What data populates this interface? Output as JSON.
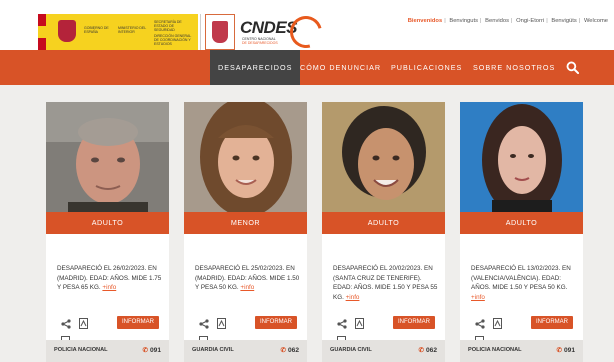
{
  "header": {
    "gov_logo": {
      "line1": "Gobierno de España",
      "line2": "Ministerio del Interior",
      "line3": "Secretaría de Estado de Seguridad",
      "line4": "Dirección General de Coordinación y Estudios"
    },
    "cndes_logo": {
      "name": "CNDES",
      "sub1": "Centro Nacional",
      "sub2": "de Desaparecidos"
    },
    "languages": [
      "Bienvenidos",
      "Benvinguts",
      "Benvidos",
      "Ongi-Etorri",
      "Benvigüts",
      "Welcome"
    ],
    "active_language": "Bienvenidos"
  },
  "nav": {
    "items": [
      "DESAPARECIDOS",
      "CÓMO DENUNCIAR",
      "PUBLICACIONES",
      "SOBRE NOSOTROS"
    ],
    "active": "DESAPARECIDOS",
    "search_icon": "search-icon"
  },
  "colors": {
    "accent": "#d85327",
    "nav_active": "#444444",
    "background": "#efeeec"
  },
  "cards": [
    {
      "category": "ADULTO",
      "description": "DESAPARECIÓ EL 26/02/2023. EN (MADRID). EDAD: AÑOS. MIDE 1.75 Y PESA 65 KG.",
      "more_link": "+info",
      "action": "INFORMAR",
      "agency": "POLICIA NACIONAL",
      "phone": "091"
    },
    {
      "category": "MENOR",
      "description": "DESAPARECIÓ EL 25/02/2023. EN (MADRID). EDAD: AÑOS. MIDE 1.50 Y PESA 50 KG.",
      "more_link": "+info",
      "action": "INFORMAR",
      "agency": "GUARDIA CIVIL",
      "phone": "062"
    },
    {
      "category": "ADULTO",
      "description": "DESAPARECIÓ EL 20/02/2023. EN (SANTA CRUZ DE TENERIFE). EDAD: AÑOS. MIDE 1.50 Y PESA 55 KG.",
      "more_link": "+info",
      "action": "INFORMAR",
      "agency": "GUARDIA CIVIL",
      "phone": "062"
    },
    {
      "category": "ADULTO",
      "description": "DESAPARECIÓ EL 13/02/2023. EN (VALENCIA/VALÈNCIA). EDAD: AÑOS. MIDE 1.50 Y PESA 50 KG.",
      "more_link": "+info",
      "action": "INFORMAR",
      "agency": "POLICIA NACIONAL",
      "phone": "091"
    }
  ]
}
